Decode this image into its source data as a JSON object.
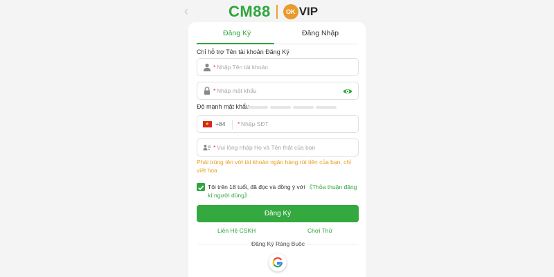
{
  "header": {
    "brand_left": "CM88",
    "brand_badge": "OK",
    "brand_right": "VIP"
  },
  "tabs": [
    {
      "label": "Đăng Ký",
      "active": true
    },
    {
      "label": "Đăng Nhập",
      "active": false
    }
  ],
  "form": {
    "username_hint": "Chỉ hỗ trợ Tên tài khoản Đăng Ký",
    "required_mark": "*",
    "username_placeholder": "Nhập Tên tài khoản",
    "password_placeholder": "Nhập mật khẩu",
    "password_strength_label": "Độ mạnh mật khẩu",
    "password_strength_level": 0,
    "phone_dial_code": "+84",
    "phone_placeholder": "Nhập SĐT",
    "fullname_placeholder": "Vui lòng nhập Họ và Tên thật của bạn",
    "fullname_warning": "Phải trùng tên với tài khoản ngân hàng rút tiền của bạn, chỉ viết hoa",
    "terms_checked": true,
    "terms_text": "Tôi trên 18 tuổi, đã đọc và đồng ý với",
    "terms_link": "《Thỏa thuận đăng kí người dùng》",
    "submit_label": "Đăng Ký"
  },
  "links": {
    "support": "Liên Hệ CSKH",
    "trial": "Chơi Thử"
  },
  "social": {
    "title": "Đăng Ký Ràng Buộc"
  },
  "colors": {
    "accent": "#2fa63d",
    "warning": "#e8a020",
    "required": "#e0332e"
  },
  "icons": {
    "back": "chevron-left-icon",
    "username": "user-icon",
    "password": "lock-icon",
    "toggle_password": "eye-icon",
    "country": "vietnam-flag-icon",
    "fullname": "id-card-icon",
    "terms": "check-icon",
    "google": "google-icon"
  }
}
